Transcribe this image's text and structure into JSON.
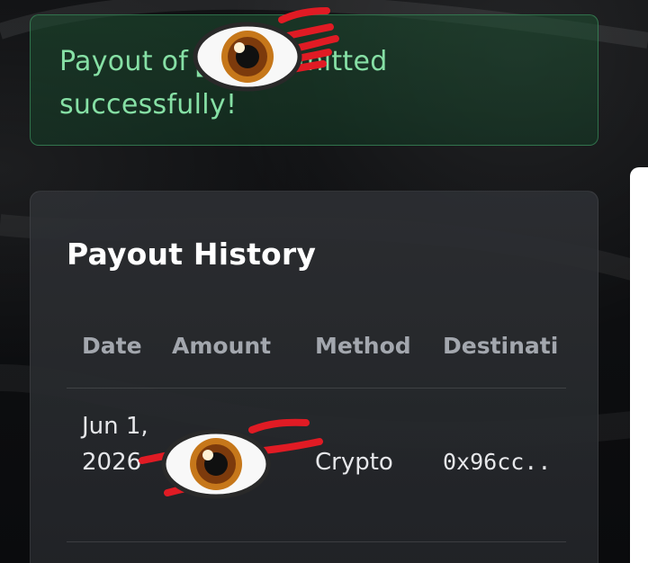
{
  "alert": {
    "message": "Payout of ██ submitted successfully!",
    "status_color": "#86e0a5"
  },
  "payout_history": {
    "title": "Payout History",
    "columns": [
      "Date",
      "Amount",
      "Method",
      "Destinati"
    ],
    "rows": [
      {
        "date": "Jun 1, 2026",
        "amount": "",
        "method": "Crypto",
        "destination": "0x96cc.."
      }
    ]
  },
  "redaction": {
    "icon": "eye-emoji-icon",
    "mark_color": "#e01b24"
  }
}
